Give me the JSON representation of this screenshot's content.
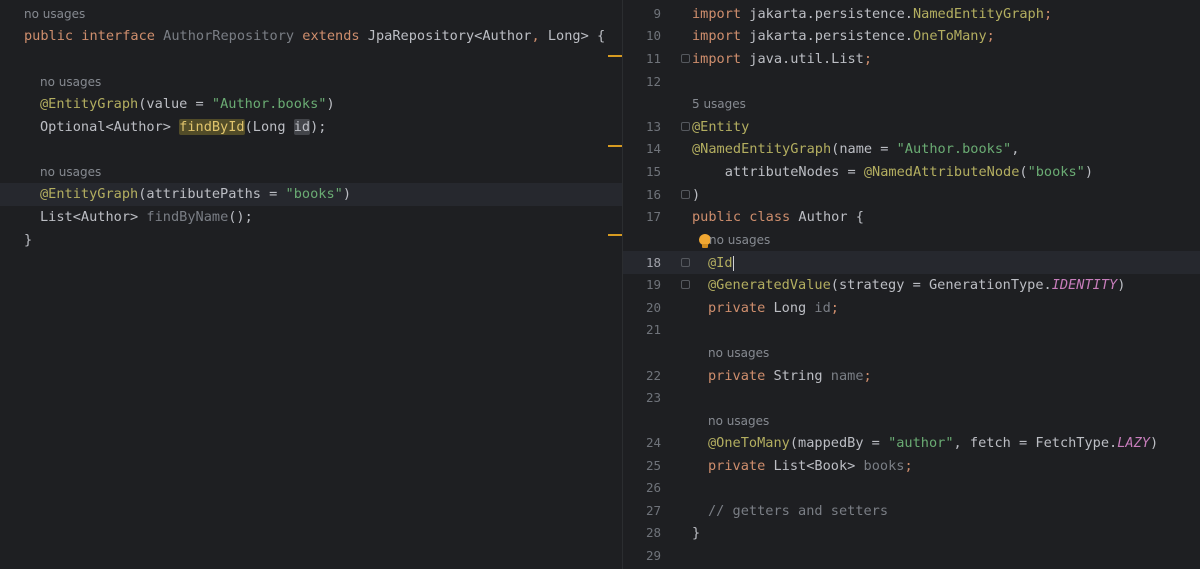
{
  "left_editor": {
    "hint_top": "no usages",
    "line1": {
      "kw1": "public",
      "kw2": "interface",
      "name": "AuthorRepository",
      "kw3": "extends",
      "parent": "JpaRepository<Author",
      "comma": ",",
      "rest": " Long> {"
    },
    "hint_method1": "no usages",
    "line2": {
      "ann": "@EntityGraph",
      "open": "(value = ",
      "str": "\"Author.books\"",
      "close": ")"
    },
    "line3": {
      "type": "Optional<Author> ",
      "method": "findById",
      "params": "(Long ",
      "param": "id",
      "end": ");"
    },
    "hint_method2": "no usages",
    "line4": {
      "ann": "@EntityGraph",
      "open": "(attributePaths = ",
      "str": "\"books\"",
      "close": ")"
    },
    "line5": {
      "type": "List<Author> ",
      "method": "findByName",
      "end": "();"
    },
    "line6": "}"
  },
  "right_editor": {
    "line_numbers": [
      "9",
      "10",
      "11",
      "12",
      "13",
      "14",
      "15",
      "16",
      "17",
      "18",
      "19",
      "20",
      "21",
      "22",
      "23",
      "24",
      "25",
      "26",
      "27",
      "28",
      "29"
    ],
    "current_line": "18",
    "l9": {
      "kw": "import",
      "pre": " jakarta.persistence.",
      "cls": "NamedEntityGraph",
      "end": ";"
    },
    "l10": {
      "kw": "import",
      "pre": " jakarta.persistence.",
      "cls": "OneToMany",
      "end": ";"
    },
    "l11": {
      "kw": "import",
      "pre": " java.util.List",
      "end": ";"
    },
    "usages_class": "5 usages",
    "l13": {
      "ann": "@Entity"
    },
    "l14": {
      "ann": "@NamedEntityGraph",
      "open": "(name = ",
      "str": "\"Author.books\"",
      "end": ","
    },
    "l15": {
      "text": "    attributeNodes = ",
      "ann": "@NamedAttributeNode",
      "open": "(",
      "str": "\"books\"",
      "close": ")"
    },
    "l16": ")",
    "l17": {
      "kw1": "public",
      "kw2": "class",
      "name": " Author {"
    },
    "hint_id": "no usages",
    "l18": {
      "ann": "@Id"
    },
    "l19": {
      "ann": "@GeneratedValue",
      "open": "(strategy = GenerationType.",
      "fld": "IDENTITY",
      "close": ")"
    },
    "l20": {
      "kw": "private",
      "type": " Long ",
      "field": "id",
      "end": ";"
    },
    "hint_name": "no usages",
    "l22": {
      "kw": "private",
      "type": " String ",
      "field": "name",
      "end": ";"
    },
    "hint_books": "no usages",
    "l24": {
      "ann": "@OneToMany",
      "open": "(mappedBy = ",
      "str": "\"author\"",
      "mid": ", fetch = FetchType.",
      "fld": "LAZY",
      "close": ")"
    },
    "l25": {
      "kw": "private",
      "type": " List<Book> ",
      "field": "books",
      "end": ";"
    },
    "l27": "// getters and setters",
    "l28": "}"
  },
  "colors": {
    "background": "#1e1f22",
    "keyword": "#cf8e6d",
    "annotation": "#b3ae60",
    "string": "#6aab73",
    "static_field": "#c77dbb",
    "marker": "#d79b21"
  }
}
